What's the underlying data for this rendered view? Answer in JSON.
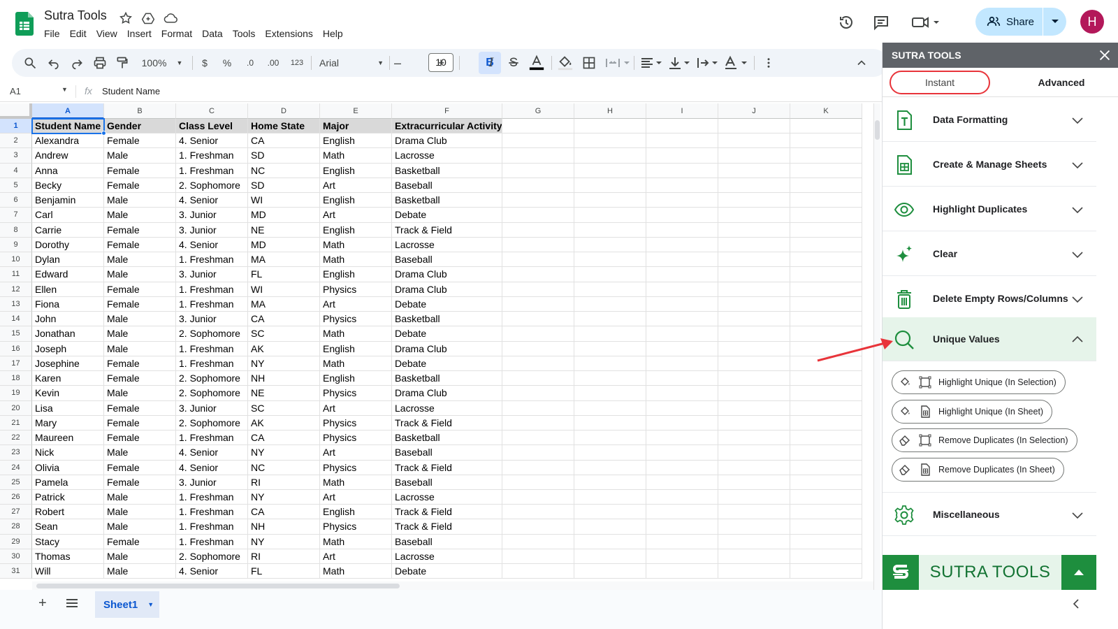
{
  "app": {
    "doc_title": "Sutra Tools",
    "menu": [
      "File",
      "Edit",
      "View",
      "Insert",
      "Format",
      "Data",
      "Tools",
      "Extensions",
      "Help"
    ],
    "share_label": "Share",
    "avatar_letter": "H"
  },
  "toolbar": {
    "zoom": "100%",
    "currency": "$",
    "percent": "%",
    "dec_decrease": ".0",
    "dec_increase": ".00",
    "number_format": "123",
    "font": "Arial",
    "font_size": "10",
    "bold": "B",
    "italic": "I"
  },
  "formula_bar": {
    "name_box": "A1",
    "fx": "fx",
    "formula": "Student Name"
  },
  "sheet": {
    "columns": [
      "A",
      "B",
      "C",
      "D",
      "E",
      "F",
      "G",
      "H",
      "I",
      "J",
      "K"
    ],
    "header_row": [
      "Student Name",
      "Gender",
      "Class Level",
      "Home State",
      "Major",
      "Extracurricular Activity"
    ],
    "rows": [
      [
        "Alexandra",
        "Female",
        "4. Senior",
        "CA",
        "English",
        "Drama Club"
      ],
      [
        "Andrew",
        "Male",
        "1. Freshman",
        "SD",
        "Math",
        "Lacrosse"
      ],
      [
        "Anna",
        "Female",
        "1. Freshman",
        "NC",
        "English",
        "Basketball"
      ],
      [
        "Becky",
        "Female",
        "2. Sophomore",
        "SD",
        "Art",
        "Baseball"
      ],
      [
        "Benjamin",
        "Male",
        "4. Senior",
        "WI",
        "English",
        "Basketball"
      ],
      [
        "Carl",
        "Male",
        "3. Junior",
        "MD",
        "Art",
        "Debate"
      ],
      [
        "Carrie",
        "Female",
        "3. Junior",
        "NE",
        "English",
        "Track & Field"
      ],
      [
        "Dorothy",
        "Female",
        "4. Senior",
        "MD",
        "Math",
        "Lacrosse"
      ],
      [
        "Dylan",
        "Male",
        "1. Freshman",
        "MA",
        "Math",
        "Baseball"
      ],
      [
        "Edward",
        "Male",
        "3. Junior",
        "FL",
        "English",
        "Drama Club"
      ],
      [
        "Ellen",
        "Female",
        "1. Freshman",
        "WI",
        "Physics",
        "Drama Club"
      ],
      [
        "Fiona",
        "Female",
        "1. Freshman",
        "MA",
        "Art",
        "Debate"
      ],
      [
        "John",
        "Male",
        "3. Junior",
        "CA",
        "Physics",
        "Basketball"
      ],
      [
        "Jonathan",
        "Male",
        "2. Sophomore",
        "SC",
        "Math",
        "Debate"
      ],
      [
        "Joseph",
        "Male",
        "1. Freshman",
        "AK",
        "English",
        "Drama Club"
      ],
      [
        "Josephine",
        "Female",
        "1. Freshman",
        "NY",
        "Math",
        "Debate"
      ],
      [
        "Karen",
        "Female",
        "2. Sophomore",
        "NH",
        "English",
        "Basketball"
      ],
      [
        "Kevin",
        "Male",
        "2. Sophomore",
        "NE",
        "Physics",
        "Drama Club"
      ],
      [
        "Lisa",
        "Female",
        "3. Junior",
        "SC",
        "Art",
        "Lacrosse"
      ],
      [
        "Mary",
        "Female",
        "2. Sophomore",
        "AK",
        "Physics",
        "Track & Field"
      ],
      [
        "Maureen",
        "Female",
        "1. Freshman",
        "CA",
        "Physics",
        "Basketball"
      ],
      [
        "Nick",
        "Male",
        "4. Senior",
        "NY",
        "Art",
        "Baseball"
      ],
      [
        "Olivia",
        "Female",
        "4. Senior",
        "NC",
        "Physics",
        "Track & Field"
      ],
      [
        "Pamela",
        "Female",
        "3. Junior",
        "RI",
        "Math",
        "Baseball"
      ],
      [
        "Patrick",
        "Male",
        "1. Freshman",
        "NY",
        "Art",
        "Lacrosse"
      ],
      [
        "Robert",
        "Male",
        "1. Freshman",
        "CA",
        "English",
        "Track & Field"
      ],
      [
        "Sean",
        "Male",
        "1. Freshman",
        "NH",
        "Physics",
        "Track & Field"
      ],
      [
        "Stacy",
        "Female",
        "1. Freshman",
        "NY",
        "Math",
        "Baseball"
      ],
      [
        "Thomas",
        "Male",
        "2. Sophomore",
        "RI",
        "Art",
        "Lacrosse"
      ],
      [
        "Will",
        "Male",
        "4. Senior",
        "FL",
        "Math",
        "Debate"
      ]
    ],
    "tab_name": "Sheet1"
  },
  "sidebar": {
    "title": "SUTRA TOOLS",
    "tabs": {
      "instant": "Instant",
      "advanced": "Advanced"
    },
    "sections": [
      {
        "label": "Data Formatting",
        "icon": "text-format-icon"
      },
      {
        "label": "Create & Manage Sheets",
        "icon": "sheet-icon"
      },
      {
        "label": "Highlight Duplicates",
        "icon": "eye-icon"
      },
      {
        "label": "Clear",
        "icon": "sparkle-icon"
      },
      {
        "label": "Delete Empty Rows/Columns",
        "icon": "trash-icon"
      },
      {
        "label": "Unique Values",
        "icon": "search-icon"
      },
      {
        "label": "Miscellaneous",
        "icon": "gear-icon"
      }
    ],
    "unique_actions": [
      "Highlight Unique (In Selection)",
      "Highlight Unique (In Sheet)",
      "Remove Duplicates (In Selection)",
      "Remove Duplicates (In Sheet)"
    ],
    "footer_text": "SUTRA TOOLS"
  },
  "colors": {
    "accent_green": "#1e8e3e",
    "share_bg": "#c2e7ff",
    "annotation_red": "#e8343a",
    "avatar": "#b3185a"
  }
}
